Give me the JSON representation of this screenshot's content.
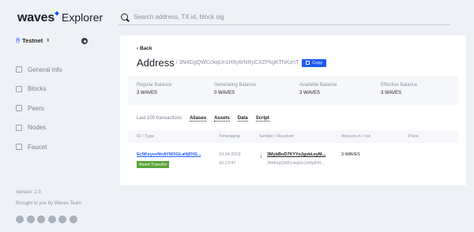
{
  "logo": {
    "wordmark": "waves",
    "product": "Explorer"
  },
  "network": {
    "label": "Testnet",
    "icon": "broadcast-icon"
  },
  "nav": [
    {
      "label": "General info",
      "icon": "info-icon"
    },
    {
      "label": "Blocks",
      "icon": "blocks-icon"
    },
    {
      "label": "Peers",
      "icon": "peers-icon"
    },
    {
      "label": "Nodes",
      "icon": "nodes-icon"
    },
    {
      "label": "Faucet",
      "icon": "faucet-icon"
    }
  ],
  "footer": {
    "version": "Version: 2.3",
    "brought": "Brought to you by Waves Team",
    "socials": [
      "github-icon",
      "twitter-icon",
      "facebook-icon",
      "vk-icon",
      "telegram-icon",
      "reddit-icon"
    ]
  },
  "search": {
    "placeholder": "Search address, TX id, block sig"
  },
  "address": {
    "back": "Back",
    "title": "Address",
    "value": "/ 3N4GgQWCckqUn1H9y8rNRyCXZPkgKTNKznT",
    "copy": "Copy"
  },
  "balances": [
    {
      "label": "Regular Balance",
      "value": "3 WAVES"
    },
    {
      "label": "Generating Balance",
      "value": "0 WAVES"
    },
    {
      "label": "Available Balance",
      "value": "3 WAVES"
    },
    {
      "label": "Effective Balance",
      "value": "3 WAVES"
    }
  ],
  "tabs": [
    "Last 100 transactions",
    "Aliases",
    "Assets",
    "Data",
    "Script"
  ],
  "table": {
    "headers": [
      "ID / Type",
      "Timestamp",
      "Sender / Receiver",
      "Amount in / out",
      "Price"
    ],
    "rows": [
      {
        "id": "Ec5KeyeoNnAYWXGLaHjFHS...",
        "type": "Asset Transfer",
        "date": "10.04.2019",
        "time": "16:23:47",
        "sender": "3MybBnD7KYYoJgvbLeyM...",
        "receiver": "3N4GgQWCckqUn1H9y8rN...",
        "amount": "3 WAVES"
      }
    ]
  },
  "colors": {
    "accent": "#1f5af6",
    "badge": "#5aa539",
    "background": "#eef1f6"
  }
}
